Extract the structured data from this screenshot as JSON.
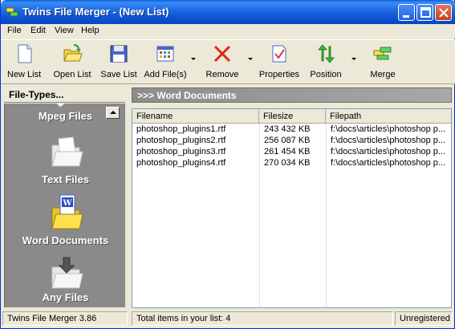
{
  "window": {
    "title": "Twins File Merger - (New List)"
  },
  "menu": [
    "File",
    "Edit",
    "View",
    "Help"
  ],
  "toolbar": {
    "new_list": "New List",
    "open_list": "Open List",
    "save_list": "Save List",
    "add_files": "Add File(s)",
    "remove": "Remove",
    "properties": "Properties",
    "position": "Position",
    "merge": "Merge"
  },
  "left_panel": {
    "header": "File-Types...",
    "categories": [
      "Mpeg Files",
      "Text Files",
      "Word Documents",
      "Any Files"
    ]
  },
  "right_panel": {
    "header": ">>> Word Documents",
    "columns": [
      "Filename",
      "Filesize",
      "Filepath"
    ],
    "rows": [
      {
        "filename": "photoshop_plugins1.rtf",
        "filesize": "243 432 KB",
        "filepath": "f:\\docs\\articles\\photoshop p..."
      },
      {
        "filename": "photoshop_plugins2.rtf",
        "filesize": "256 087 KB",
        "filepath": "f:\\docs\\articles\\photoshop p..."
      },
      {
        "filename": "photoshop_plugins3.rtf",
        "filesize": "261 454 KB",
        "filepath": "f:\\docs\\articles\\photoshop p..."
      },
      {
        "filename": "photoshop_plugins4.rtf",
        "filesize": "270 034 KB",
        "filepath": "f:\\docs\\articles\\photoshop p..."
      }
    ]
  },
  "status": {
    "version": "Twins File Merger 3.86",
    "total": "Total items in your list: 4",
    "registration": "Unregistered"
  },
  "colors": {
    "titlebar": "#0a5fd8",
    "panel_gray": "#8a8a8a",
    "window_bg": "#ece9d8"
  }
}
